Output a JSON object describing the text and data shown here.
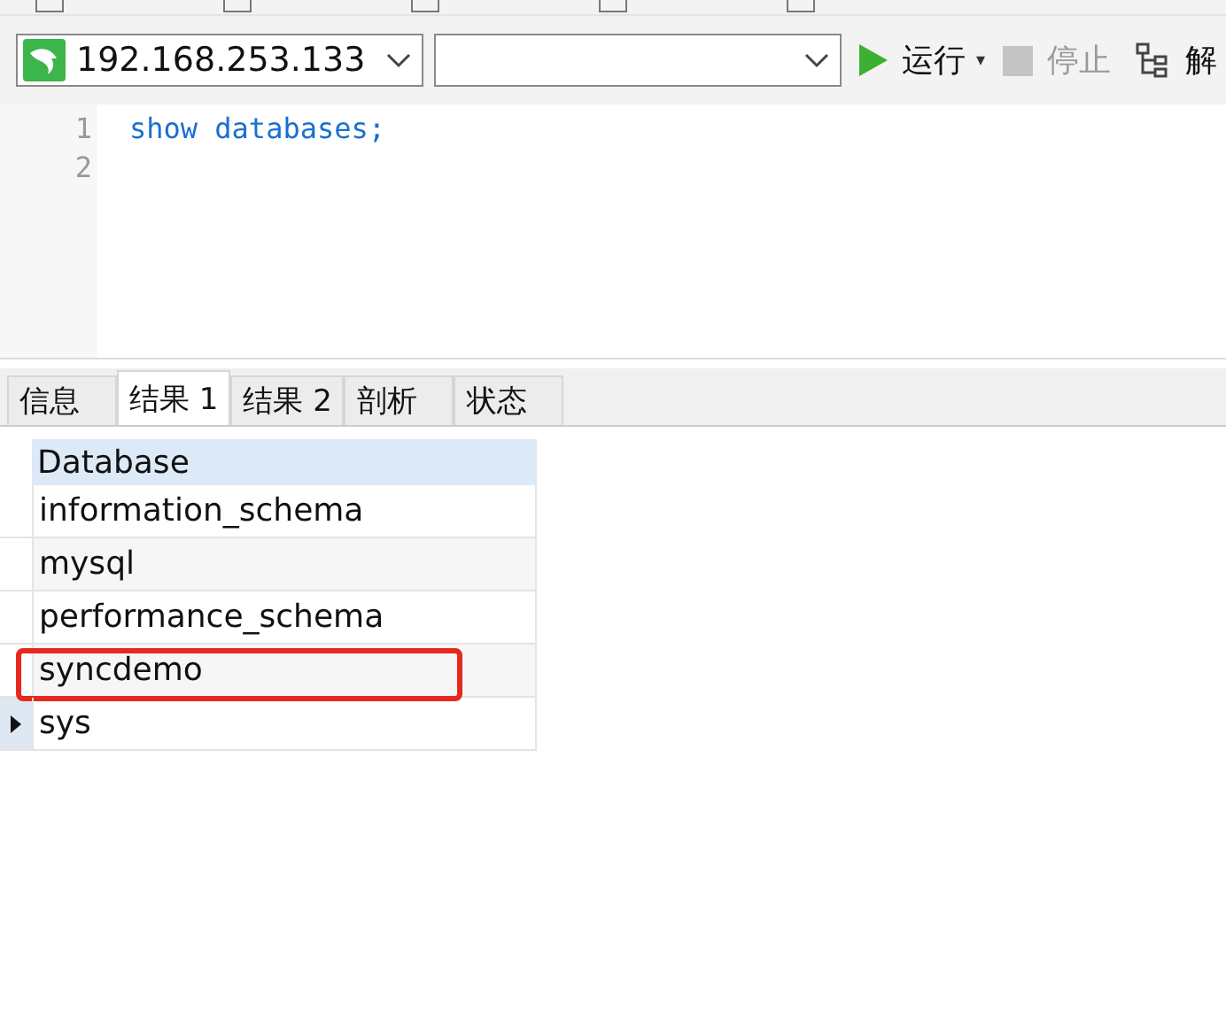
{
  "toolbar": {
    "connection": "192.168.253.133",
    "run": {
      "label": "运行",
      "caret": "▾",
      "disabled": false
    },
    "stop": {
      "label": "停止",
      "disabled": true
    },
    "explain": {
      "label": "解"
    }
  },
  "editor": {
    "lines": [
      {
        "number": "1",
        "code": "show databases;"
      },
      {
        "number": "2"
      }
    ]
  },
  "tabs": [
    {
      "label": "信息",
      "selected": false
    },
    {
      "label": "结果 1",
      "selected": true
    },
    {
      "label": "结果 2",
      "selected": false
    },
    {
      "label": "剖析",
      "selected": false
    },
    {
      "label": "状态",
      "selected": false
    }
  ],
  "grid": {
    "columns": [
      "Database"
    ],
    "rows": [
      {
        "cells": [
          "information_schema"
        ],
        "current": false,
        "highlighted": false
      },
      {
        "cells": [
          "mysql"
        ],
        "current": false,
        "highlighted": false
      },
      {
        "cells": [
          "performance_schema"
        ],
        "current": false,
        "highlighted": false
      },
      {
        "cells": [
          "syncdemo"
        ],
        "current": false,
        "highlighted": true
      },
      {
        "cells": [
          "sys"
        ],
        "current": true,
        "highlighted": false
      }
    ]
  }
}
